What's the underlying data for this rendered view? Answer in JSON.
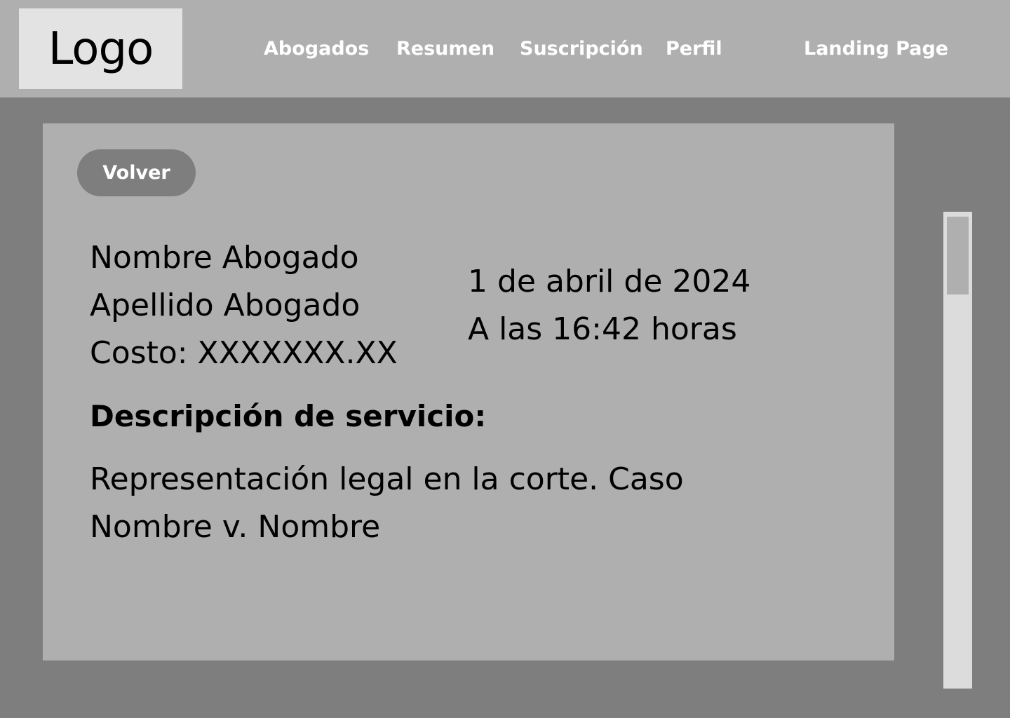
{
  "header": {
    "logo": "Logo",
    "nav": {
      "abogados": "Abogados",
      "resumen": "Resumen",
      "suscripcion": "Suscripción",
      "perfil": "Perfil",
      "landing": "Landing Page"
    }
  },
  "card": {
    "back_label": "Volver",
    "lawyer_first_name": "Nombre Abogado",
    "lawyer_last_name": "Apellido Abogado",
    "cost": "Costo: XXXXXXX.XX",
    "date": "1 de abril de 2024",
    "time": "A las 16:42 horas",
    "description_title": "Descripción de servicio:",
    "description_text": "Representación legal en la corte. Caso Nombre v. Nombre"
  },
  "colors": {
    "page_background": "#7e7e7e",
    "header_background": "#afafaf",
    "card_background": "#afafaf",
    "logo_background": "#e3e3e3",
    "scroll_track": "#dcdcdc"
  }
}
